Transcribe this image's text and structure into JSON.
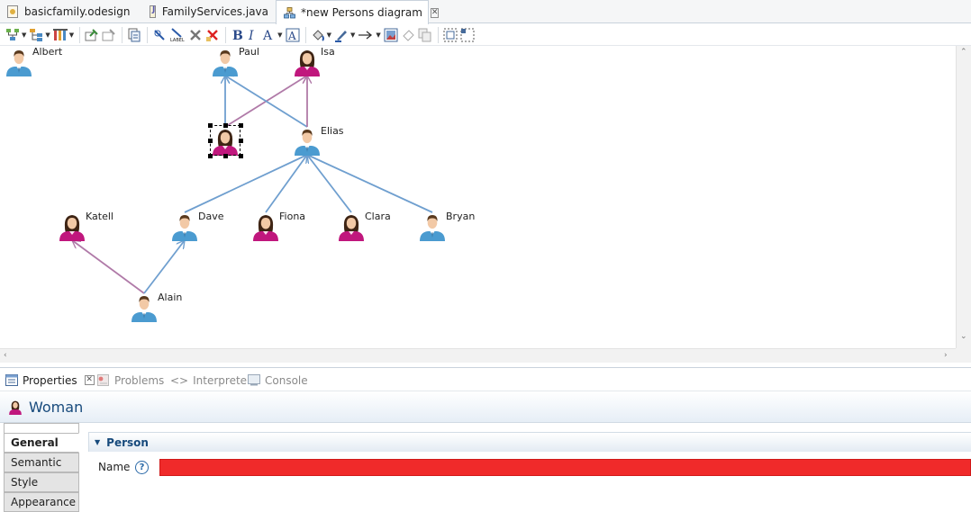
{
  "editor_tabs": [
    {
      "label": "basicfamily.odesign",
      "active": false
    },
    {
      "label": "FamilyServices.java",
      "active": false
    },
    {
      "label": "*new Persons diagram",
      "active": true
    }
  ],
  "diagram": {
    "nodes": [
      {
        "id": "albert",
        "label": "Albert",
        "gender": "man"
      },
      {
        "id": "paul",
        "label": "Paul",
        "gender": "man"
      },
      {
        "id": "isa",
        "label": "Isa",
        "gender": "woman"
      },
      {
        "id": "selected",
        "label": "",
        "gender": "woman",
        "selected": true
      },
      {
        "id": "elias",
        "label": "Elias",
        "gender": "man"
      },
      {
        "id": "katell",
        "label": "Katell",
        "gender": "woman"
      },
      {
        "id": "dave",
        "label": "Dave",
        "gender": "man"
      },
      {
        "id": "fiona",
        "label": "Fiona",
        "gender": "woman"
      },
      {
        "id": "clara",
        "label": "Clara",
        "gender": "woman"
      },
      {
        "id": "bryan",
        "label": "Bryan",
        "gender": "man"
      },
      {
        "id": "alain",
        "label": "Alain",
        "gender": "man"
      }
    ],
    "edges": [
      {
        "from": "selected",
        "to": "paul",
        "kind": "father"
      },
      {
        "from": "selected",
        "to": "isa",
        "kind": "mother"
      },
      {
        "from": "elias",
        "to": "paul",
        "kind": "father"
      },
      {
        "from": "elias",
        "to": "isa",
        "kind": "mother"
      },
      {
        "from": "dave",
        "to": "elias",
        "kind": "father"
      },
      {
        "from": "fiona",
        "to": "elias",
        "kind": "father"
      },
      {
        "from": "clara",
        "to": "elias",
        "kind": "father"
      },
      {
        "from": "bryan",
        "to": "elias",
        "kind": "father"
      },
      {
        "from": "alain",
        "to": "katell",
        "kind": "mother"
      },
      {
        "from": "alain",
        "to": "dave",
        "kind": "father"
      }
    ],
    "colors": {
      "father_edge": "#6f9fcf",
      "mother_edge": "#b07aa8",
      "man_body": "#4b9bd0",
      "woman_body": "#c0177d",
      "skin": "#f2c9a6",
      "hair_man": "#5a3a1e",
      "hair_woman": "#3e2414"
    }
  },
  "view_tabs": [
    {
      "label": "Properties",
      "active": true
    },
    {
      "label": "Problems",
      "active": false
    },
    {
      "label": "Interpreter",
      "active": false
    },
    {
      "label": "Console",
      "active": false
    }
  ],
  "properties": {
    "title": "Woman",
    "side_tabs": [
      "General",
      "Semantic",
      "Style",
      "Appearance"
    ],
    "active_side_tab": "General",
    "section_title": "Person",
    "name_label": "Name",
    "name_value": "",
    "help_glyph": "?"
  }
}
